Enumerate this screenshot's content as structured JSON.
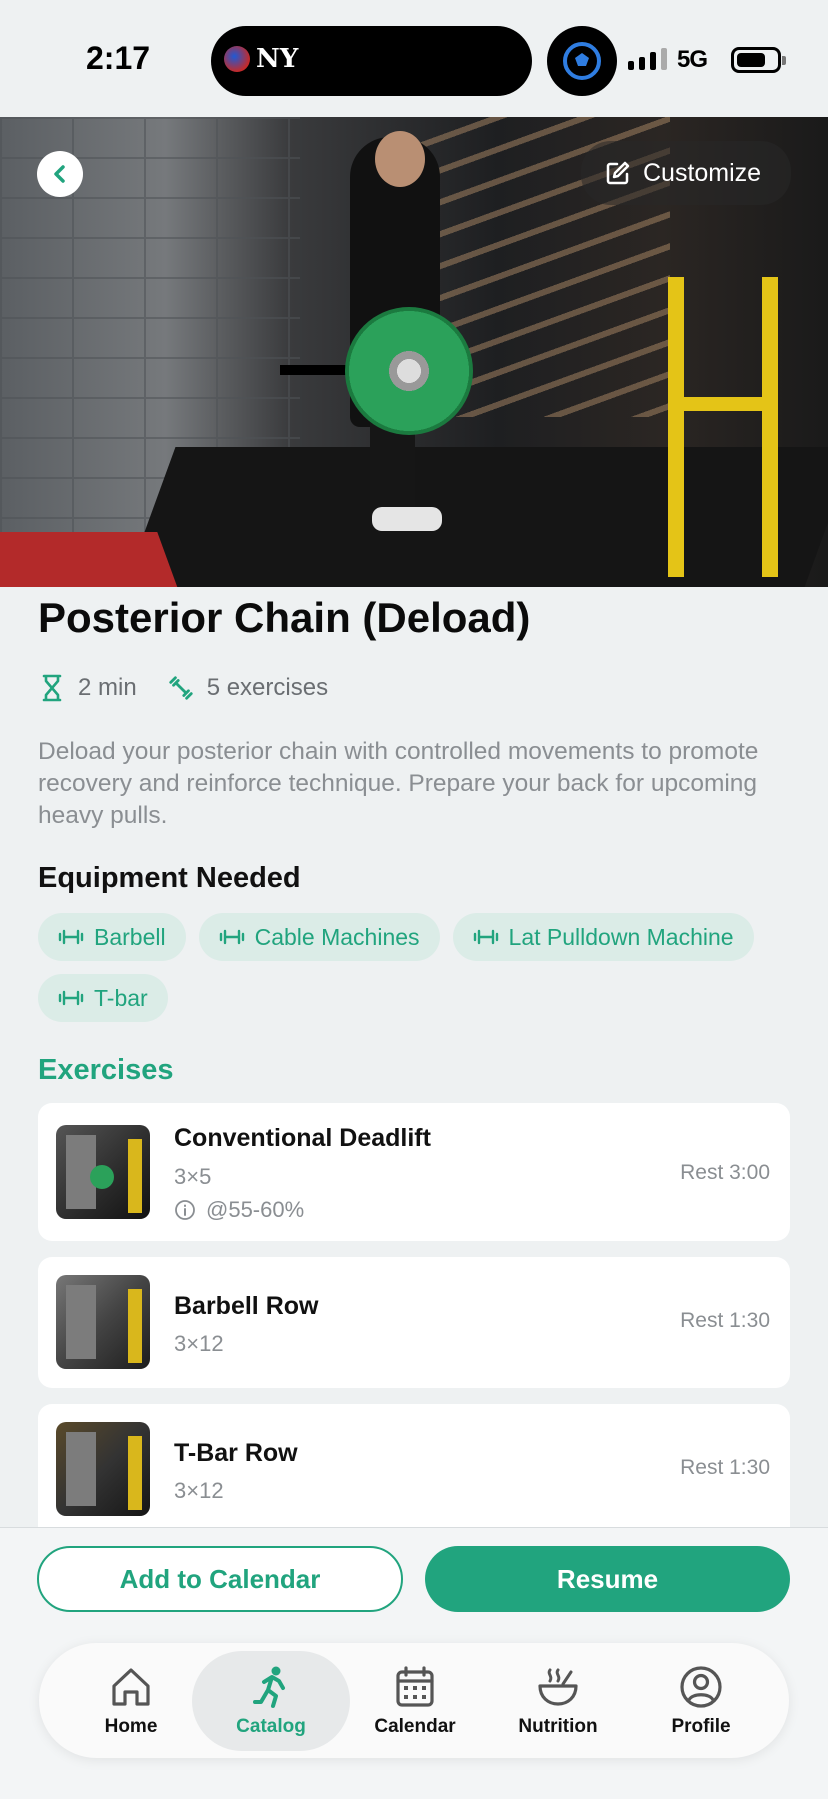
{
  "status_bar": {
    "time": "2:17",
    "network": "5G"
  },
  "header": {
    "back_label": "Back",
    "customize_label": "Customize"
  },
  "workout": {
    "title": "Posterior Chain (Deload)",
    "duration": "2 min",
    "exercise_count": "5 exercises",
    "description": "Deload your posterior chain with controlled movements to promote recovery and reinforce technique. Prepare your back for upcoming heavy pulls."
  },
  "equipment": {
    "title": "Equipment Needed",
    "items": [
      "Barbell",
      "Cable Machines",
      "Lat Pulldown Machine",
      "T-bar"
    ]
  },
  "exercises": {
    "title": "Exercises",
    "items": [
      {
        "name": "Conventional Deadlift",
        "sets": "3×5",
        "note": "@55-60%",
        "rest": "Rest 3:00"
      },
      {
        "name": "Barbell Row",
        "sets": "3×12",
        "rest": "Rest 1:30"
      },
      {
        "name": "T-Bar Row",
        "sets": "3×12",
        "rest": "Rest 1:30"
      }
    ]
  },
  "actions": {
    "add_to_calendar": "Add to Calendar",
    "resume": "Resume"
  },
  "tabs": [
    {
      "label": "Home",
      "icon": "home-icon",
      "active": false
    },
    {
      "label": "Catalog",
      "icon": "runner-icon",
      "active": true
    },
    {
      "label": "Calendar",
      "icon": "calendar-icon",
      "active": false
    },
    {
      "label": "Nutrition",
      "icon": "bowl-icon",
      "active": false
    },
    {
      "label": "Profile",
      "icon": "profile-icon",
      "active": false
    }
  ],
  "colors": {
    "accent": "#21a47e",
    "chip_bg": "#dbece7",
    "background": "#eef1f2"
  }
}
